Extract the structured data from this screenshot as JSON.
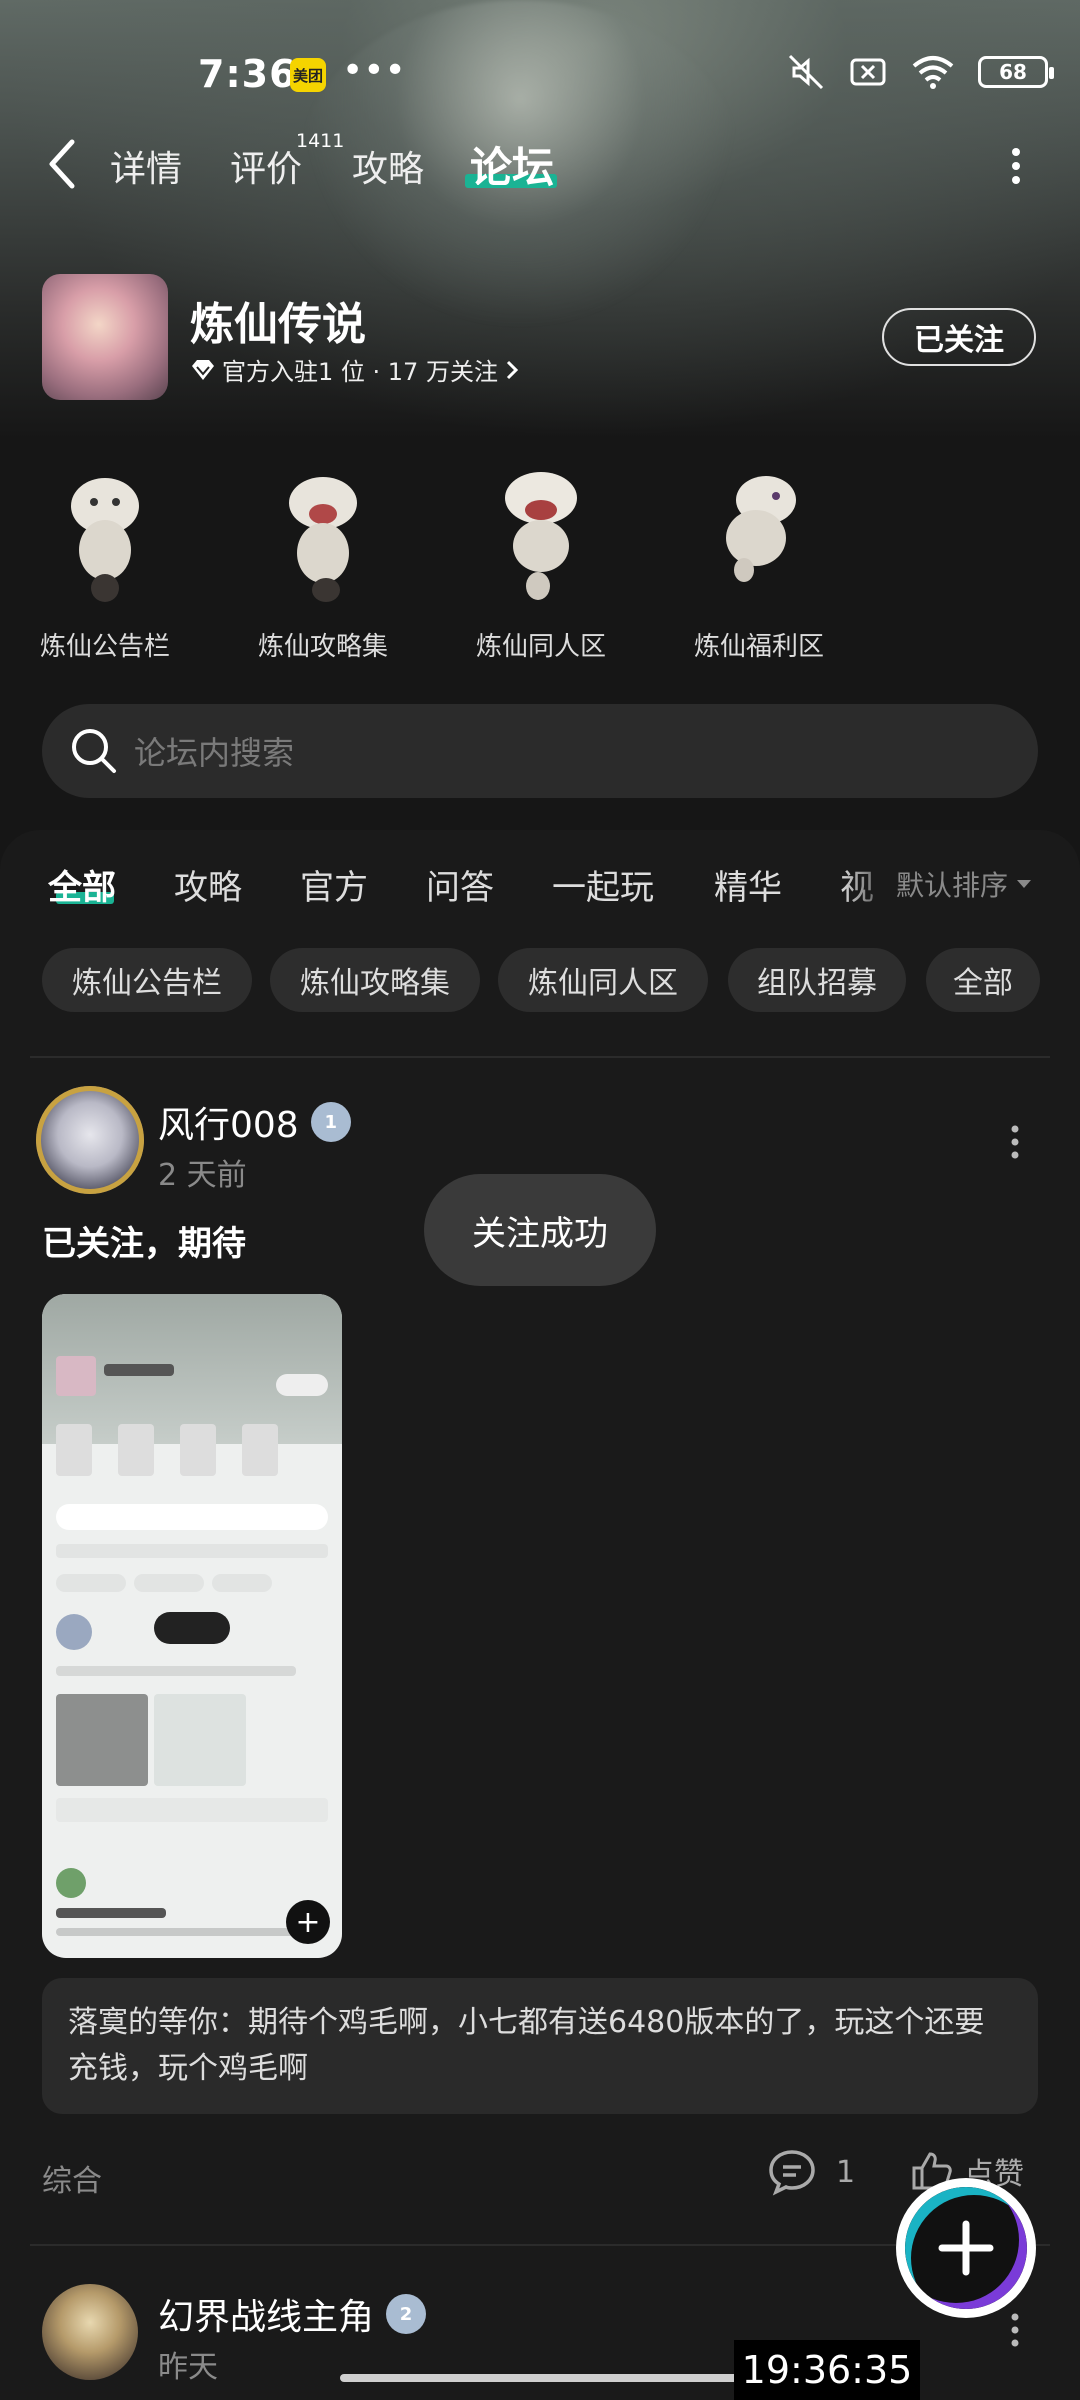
{
  "status_bar": {
    "time": "7:36",
    "app_badge": "美团",
    "dots": "•••",
    "battery": "68"
  },
  "nav": {
    "tabs": [
      "详情",
      "评价",
      "攻略",
      "论坛"
    ],
    "active_tab": "论坛",
    "review_count": "1411"
  },
  "game": {
    "title": "炼仙传说",
    "meta": "官方入驻1 位 · 17 万关注",
    "follow_button": "已关注"
  },
  "sub_forums": [
    "炼仙公告栏",
    "炼仙攻略集",
    "炼仙同人区",
    "炼仙福利区"
  ],
  "search": {
    "placeholder": "论坛内搜索"
  },
  "categories": [
    "全部",
    "攻略",
    "官方",
    "问答",
    "一起玩",
    "精华",
    "视"
  ],
  "sort": {
    "label": "默认排序"
  },
  "chips": [
    "炼仙公告栏",
    "炼仙攻略集",
    "炼仙同人区",
    "组队招募",
    "全部"
  ],
  "toast": "关注成功",
  "posts": [
    {
      "author": "风行008",
      "level": "1",
      "time": "2 天前",
      "title": "已关注，期待",
      "comment": "落寞的等你：期待个鸡毛啊，小七都有送6480版本的了，玩这个还要充钱，玩个鸡毛啊",
      "category": "综合",
      "comments": "1",
      "likes_label": "点赞"
    },
    {
      "author": "幻界战线主角",
      "level": "2",
      "time": "昨天"
    }
  ],
  "clock_overlay": "19:36:35",
  "colors": {
    "accent": "#1ab394",
    "background": "#161616"
  }
}
